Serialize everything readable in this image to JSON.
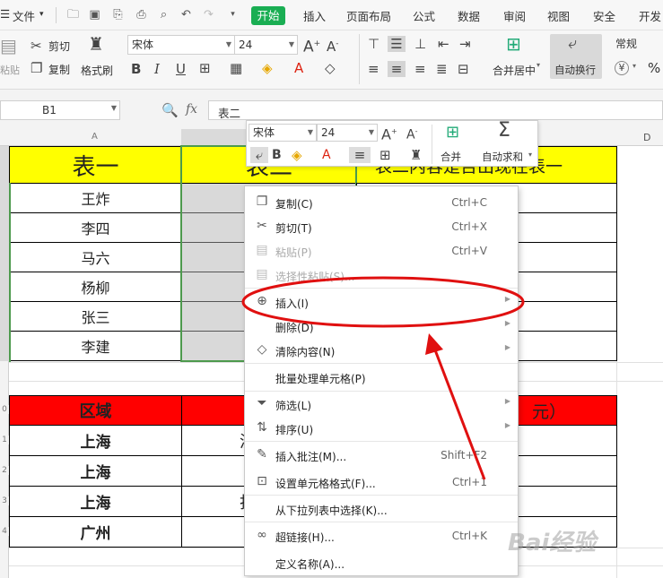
{
  "menubar": {
    "file": "文件",
    "tabs": [
      "开始",
      "插入",
      "页面布局",
      "公式",
      "数据",
      "审阅",
      "视图",
      "安全",
      "开发"
    ]
  },
  "ribbon": {
    "cut": "剪切",
    "paste": "粘贴",
    "copy": "复制",
    "format_painter": "格式刷",
    "font_name": "宋体",
    "font_size": "24",
    "merge_center": "合并居中",
    "auto_wrap": "自动换行",
    "number_format": "常规",
    "currency": "¥",
    "percent": "%"
  },
  "formula_bar": {
    "name_box": "B1",
    "fx": "fx",
    "content": "表二"
  },
  "sheet": {
    "col_headers": {
      "a": "A",
      "d": "D"
    },
    "row_headers": [
      "0",
      "1",
      "2",
      "3",
      "4"
    ],
    "table1": {
      "header_a": "表一",
      "header_b": "表二",
      "header_c": "表二内容是否出现在表一",
      "names": [
        "王炸",
        "李四",
        "马六",
        "杨柳",
        "张三",
        "李建"
      ]
    },
    "table2": {
      "header_a": "区域",
      "header_c_tail": "元）",
      "regions": [
        "上海",
        "上海",
        "上海",
        "广州"
      ],
      "col_b_partials": [
        "洗",
        "",
        "打",
        ""
      ]
    }
  },
  "mini_toolbar": {
    "font_name": "宋体",
    "font_size": "24",
    "merge": "合并",
    "autosum": "自动求和"
  },
  "context_menu": {
    "items": [
      {
        "label": "复制(C)",
        "shortcut": "Ctrl+C",
        "icon": "copy-icon"
      },
      {
        "label": "剪切(T)",
        "shortcut": "Ctrl+X",
        "icon": "scissors-icon"
      },
      {
        "label": "粘贴(P)",
        "shortcut": "Ctrl+V",
        "icon": "paste-icon"
      },
      {
        "label": "选择性粘贴(S)...",
        "shortcut": "",
        "icon": "paste-special-icon"
      },
      {
        "label": "插入(I)",
        "shortcut": "",
        "icon": "insert-cells-icon"
      },
      {
        "label": "删除(D)",
        "shortcut": "",
        "icon": ""
      },
      {
        "label": "清除内容(N)",
        "shortcut": "",
        "icon": "eraser-icon"
      },
      {
        "label": "批量处理单元格(P)",
        "shortcut": "",
        "icon": ""
      },
      {
        "label": "筛选(L)",
        "shortcut": "",
        "icon": "filter-icon"
      },
      {
        "label": "排序(U)",
        "shortcut": "",
        "icon": "sort-icon"
      },
      {
        "label": "插入批注(M)...",
        "shortcut": "Shift+F2",
        "icon": "comment-icon"
      },
      {
        "label": "设置单元格格式(F)...",
        "shortcut": "Ctrl+1",
        "icon": "format-cells-icon"
      },
      {
        "label": "从下拉列表中选择(K)...",
        "shortcut": "",
        "icon": ""
      },
      {
        "label": "超链接(H)...",
        "shortcut": "Ctrl+K",
        "icon": "link-icon"
      },
      {
        "label": "定义名称(A)...",
        "shortcut": "",
        "icon": ""
      }
    ]
  },
  "watermark": "Bai经验",
  "colors": {
    "accent_green": "#1aae53",
    "header_yellow": "#ffff00",
    "header_red": "#ff0000",
    "annotation_red": "#e01010"
  }
}
